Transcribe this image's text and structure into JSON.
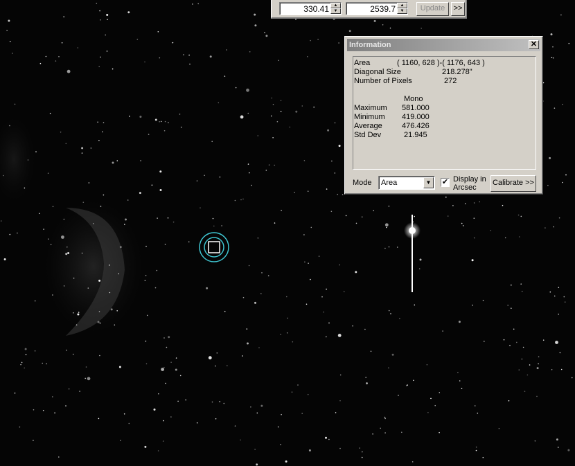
{
  "toolbar": {
    "field1_value": "330.41",
    "field2_value": "2539.7",
    "update_label": "Update",
    "more_label": ">>"
  },
  "info": {
    "title": "Information",
    "close_label": "✕",
    "area_label": "Area",
    "area_value": "( 1160, 628 )-( 1176, 643 )",
    "diag_label": "Diagonal Size",
    "diag_value": "218.278\"",
    "pixels_label": "Number of Pixels",
    "pixels_value": "272",
    "channel": "Mono",
    "max_label": "Maximum",
    "max_value": "581.000",
    "min_label": "Minimum",
    "min_value": "419.000",
    "avg_label": "Average",
    "avg_value": "476.426",
    "std_label": "Std Dev",
    "std_value": "21.945",
    "mode_label": "Mode",
    "mode_value": "Area",
    "display_label_1": "Display in",
    "display_label_2": "Arcsec",
    "display_checked": "✔",
    "calibrate_label": "Calibrate >>"
  },
  "colors": {
    "sky": "#050505",
    "marker": "#3fc6d2",
    "dialog": "#d4d0c8"
  }
}
